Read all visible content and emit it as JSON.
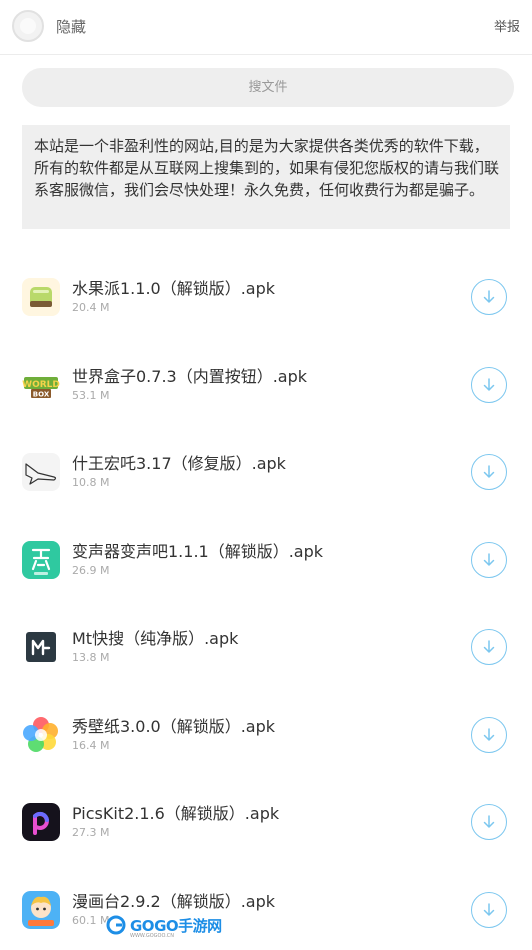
{
  "header": {
    "hide_label": "隐藏",
    "report_label": "举报"
  },
  "search": {
    "placeholder": "搜文件"
  },
  "notice": {
    "text": "本站是一个非盈利性的网站,目的是为大家提供各类优秀的软件下载，所有的软件都是从互联网上搜集到的，如果有侵犯您版权的请与我们联系客服微信，我们会尽快处理！永久免费，任何收费行为都是骗子。"
  },
  "files": [
    {
      "name": "水果派1.1.0（解锁版）.apk",
      "size": "20.4 M",
      "icon": "fruit-pie-app-icon"
    },
    {
      "name": "世界盒子0.7.3（内置按钮）.apk",
      "size": "53.1 M",
      "icon": "worldbox-app-icon"
    },
    {
      "name": "什王宏吒3.17（修复版）.apk",
      "size": "10.8 M",
      "icon": "airplane-app-icon"
    },
    {
      "name": "变声器变声吧1.1.1（解锁版）.apk",
      "size": "26.9 M",
      "icon": "voice-changer-app-icon"
    },
    {
      "name": "Mt快搜（纯净版）.apk",
      "size": "13.8 M",
      "icon": "mt-search-app-icon"
    },
    {
      "name": "秀壁纸3.0.0（解锁版）.apk",
      "size": "16.4 M",
      "icon": "wallpaper-flower-app-icon"
    },
    {
      "name": "PicsKit2.1.6（解锁版）.apk",
      "size": "27.3 M",
      "icon": "picskit-app-icon"
    },
    {
      "name": "漫画台2.9.2（解锁版）.apk",
      "size": "60.1 M",
      "icon": "comic-app-icon"
    }
  ],
  "watermark": {
    "text": "GOGO手游网",
    "sub": "WWW.GOGOO.CN"
  },
  "colors": {
    "accent": "#7cc7ef",
    "watermark": "#1d8ee6",
    "search_bg": "#eeeeee",
    "notice_bg": "#efefef"
  }
}
